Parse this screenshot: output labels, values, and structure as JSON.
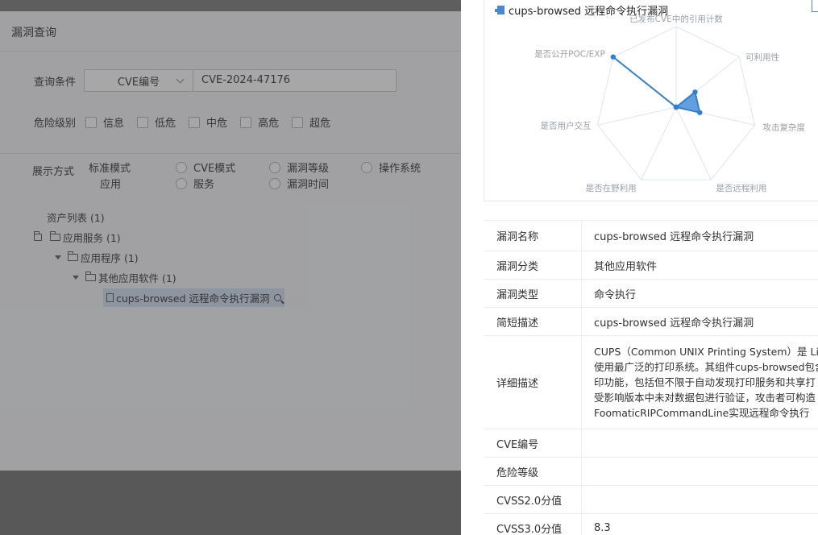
{
  "left": {
    "title": "漏洞查询",
    "query_label": "查询条件",
    "query_type": "CVE编号",
    "query_value": "CVE-2024-47176",
    "level_label": "危险级别",
    "levels": [
      "信息",
      "低危",
      "中危",
      "高危",
      "超危"
    ],
    "display_label": "展示方式",
    "modes": [
      "标准模式",
      "CVE模式",
      "漏洞等级",
      "操作系统",
      "应用",
      "服务",
      "漏洞时间"
    ],
    "tree": {
      "root": "资产列表 (1)",
      "level1": "应用服务 (1)",
      "level2": "应用程序 (1)",
      "level3": "其他应用软件 (1)",
      "leaf": "cups-browsed 远程命令执行漏洞"
    }
  },
  "drawer": {
    "chart_title": "cups-browsed 远程命令执行漏洞",
    "radar_labels": [
      "已发布CVE中的引用计数",
      "可利用性",
      "攻击复杂度",
      "是否远程利用",
      "是否在野利用",
      "是否用户交互",
      "是否公开POC/EXP"
    ],
    "rows": [
      {
        "key": "漏洞名称",
        "value": "cups-browsed 远程命令执行漏洞"
      },
      {
        "key": "漏洞分类",
        "value": "其他应用软件"
      },
      {
        "key": "漏洞类型",
        "value": "命令执行"
      },
      {
        "key": "简短描述",
        "value": "cups-browsed 远程命令执行漏洞"
      },
      {
        "key": "详细描述",
        "lines": [
          "CUPS（Common UNIX Printing System）是 Linux",
          "使用最广泛的打印系统。其组件cups-browsed包含",
          "印功能，包括但不限于自动发现打印服务和共享打",
          "受影响版本中未对数据包进行验证，攻击者可构造",
          "FoomaticRIPCommandLine实现远程命令执行"
        ]
      },
      {
        "key": "CVE编号",
        "value": ""
      },
      {
        "key": "危险等级",
        "value": ""
      },
      {
        "key": "CVSS2.0分值",
        "value": ""
      },
      {
        "key": "CVSS3.0分值",
        "value": "8.3"
      }
    ]
  },
  "chart_data": {
    "type": "radar",
    "title": "cups-browsed 远程命令执行漏洞",
    "axes": [
      "已发布CVE中的引用计数",
      "可利用性",
      "攻击复杂度",
      "是否远程利用",
      "是否在野利用",
      "是否用户交互",
      "是否公开POC/EXP"
    ],
    "values": [
      0,
      0.3,
      0.3,
      0,
      0,
      0,
      1
    ],
    "range": [
      0,
      1
    ],
    "color": "#2f7fd4"
  }
}
